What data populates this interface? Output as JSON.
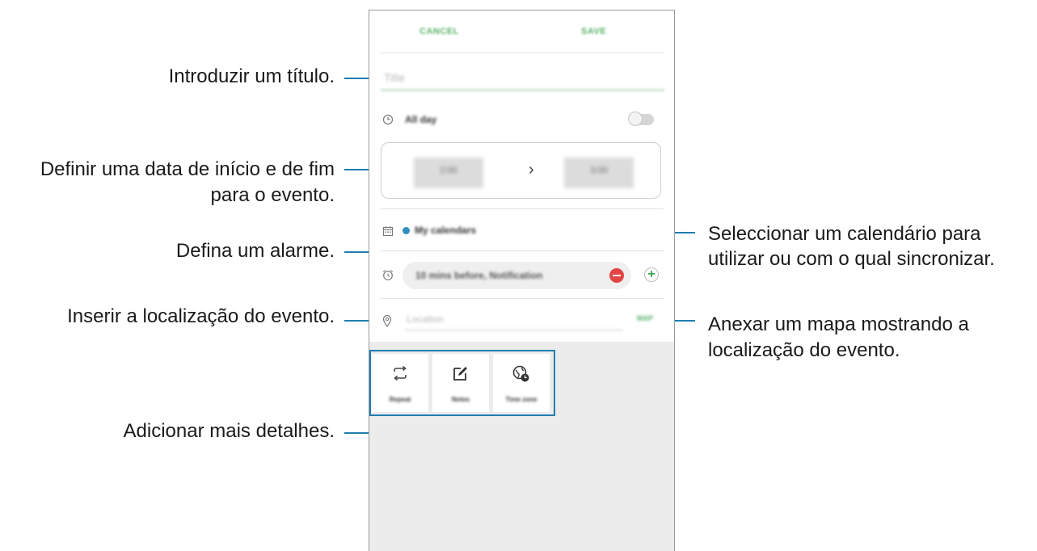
{
  "annotations": {
    "title": "Introduzir um título.",
    "date_line1": "Definir uma data de início e de fim",
    "date_line2": "para o evento.",
    "alarm": "Defina um alarme.",
    "location": "Inserir a localização do evento.",
    "details": "Adicionar mais detalhes.",
    "calendar_line1": "Seleccionar um calendário para",
    "calendar_line2": "utilizar ou com o qual sincronizar.",
    "map_line1": "Anexar um mapa mostrando a",
    "map_line2": "localização do evento."
  },
  "header": {
    "cancel_label": "CANCEL",
    "save_label": "SAVE"
  },
  "form": {
    "title_placeholder": "Title",
    "all_day_label": "All day",
    "all_day_on": false,
    "start_date": "2:00",
    "end_date": "3:00",
    "date_arrow": "›",
    "calendar_label": "My calendars",
    "calendar_color": "#2e8fc0",
    "alarm_label": "10 mins before, Notification",
    "location_placeholder": "Location",
    "map_label": "MAP"
  },
  "details": [
    {
      "icon": "repeat-icon",
      "label": "Repeat"
    },
    {
      "icon": "notes-icon",
      "label": "Notes"
    },
    {
      "icon": "time-zone-icon",
      "label": "Time zone"
    }
  ],
  "colors": {
    "accent_green": "#58b268",
    "callout_blue": "#1e7eb0",
    "remove_red": "#e24545"
  }
}
